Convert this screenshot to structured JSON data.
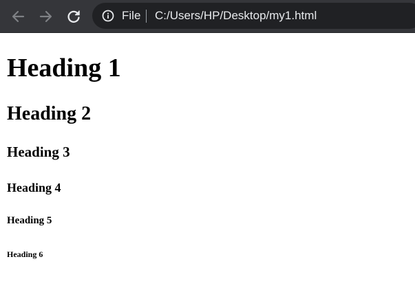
{
  "browser": {
    "nav": {
      "back_icon": "arrow-left-icon",
      "forward_icon": "arrow-right-icon",
      "reload_icon": "reload-icon"
    },
    "omnibox": {
      "security_icon": "info-icon",
      "scheme_label": "File",
      "url": "C:/Users/HP/Desktop/my1.html"
    },
    "colors": {
      "toolbar": "#35363a",
      "omnibox": "#202124",
      "text": "#e8eaed",
      "disabled_icon": "#7f8185",
      "active_icon": "#e8eaed"
    }
  },
  "page": {
    "headings": {
      "h1": "Heading 1",
      "h2": "Heading 2",
      "h3": "Heading 3",
      "h4": "Heading 4",
      "h5": "Heading 5",
      "h6": "Heading 6"
    }
  }
}
